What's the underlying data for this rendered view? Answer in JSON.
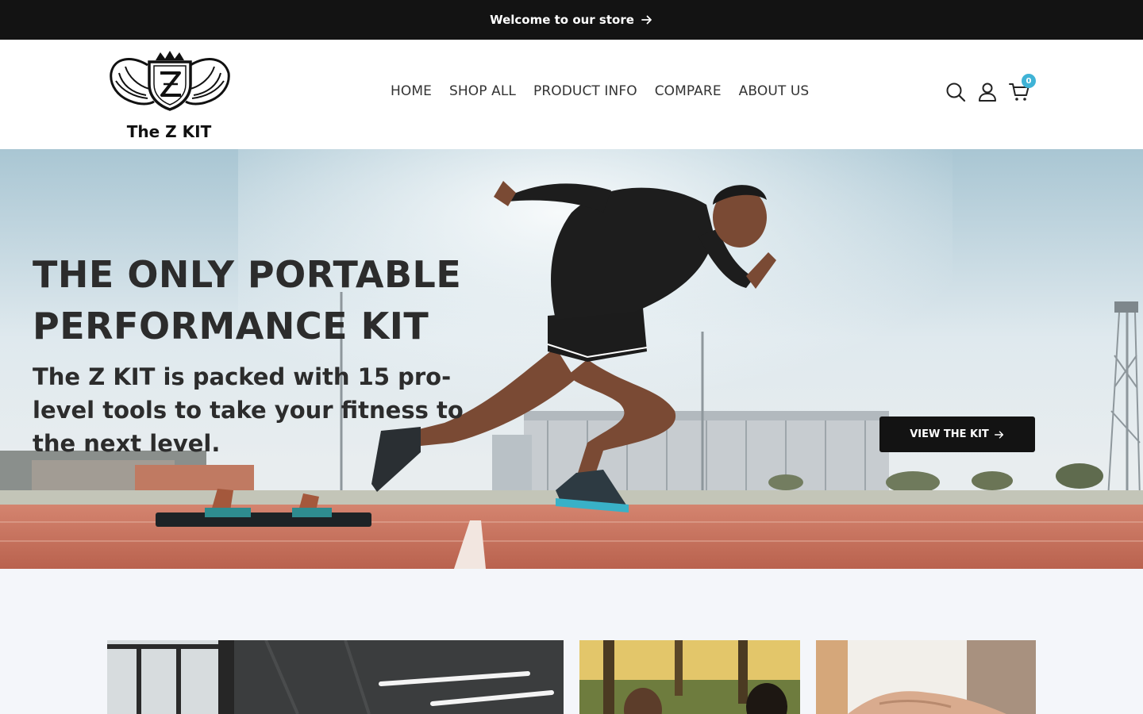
{
  "announcement": {
    "text": "Welcome to our store"
  },
  "brand": {
    "name": "The Z KIT"
  },
  "nav": {
    "items": [
      {
        "label": "HOME"
      },
      {
        "label": "SHOP ALL"
      },
      {
        "label": "PRODUCT INFO"
      },
      {
        "label": "COMPARE"
      },
      {
        "label": "ABOUT US"
      }
    ]
  },
  "header_icons": {
    "search": "search-icon",
    "account": "user-icon",
    "cart": "cart-icon",
    "cart_count": "0"
  },
  "hero": {
    "title": "THE ONLY PORTABLE PERFORMANCE KIT",
    "subtitle": "The Z KIT is packed with 15 pro-level tools to take your fitness to the next level.",
    "cta_label": "VIEW THE KIT"
  },
  "colors": {
    "announcement_bg": "#131313",
    "badge": "#3fb3d6",
    "text_dark": "#2c2c2c",
    "track": "#c9715f"
  }
}
